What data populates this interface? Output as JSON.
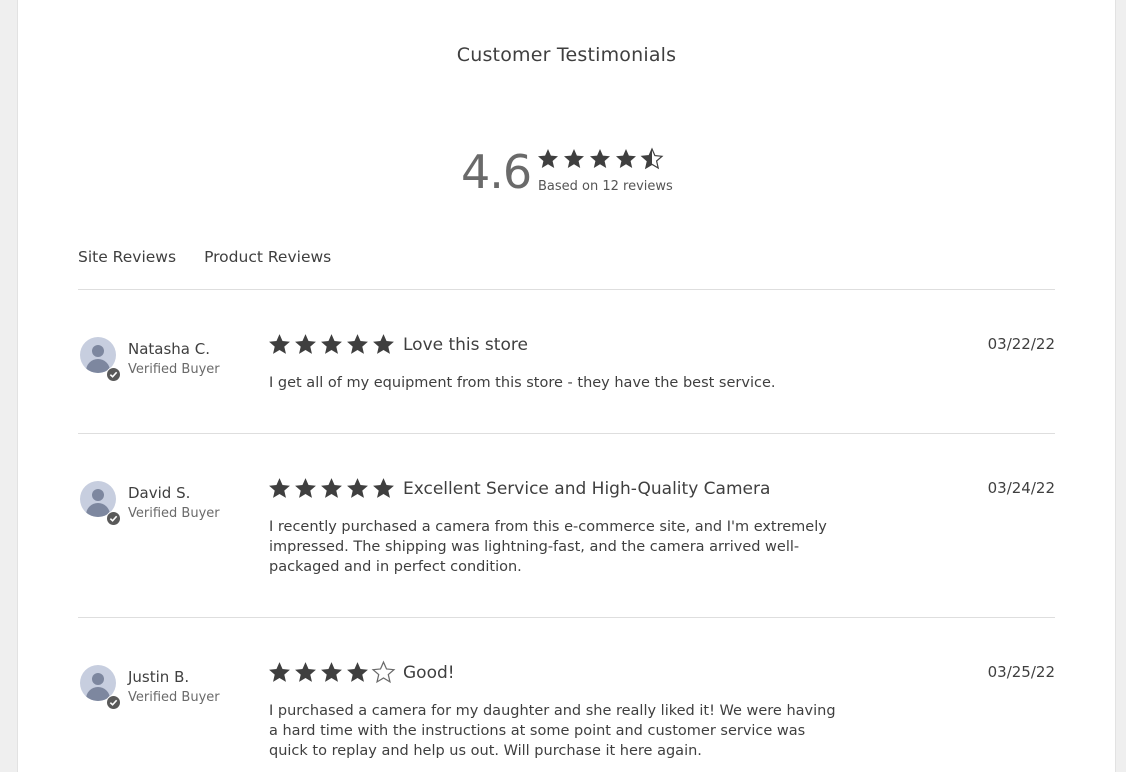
{
  "page": {
    "title": "Customer Testimonials"
  },
  "summary": {
    "average": "4.6",
    "rating_value": 4.6,
    "based_on": "Based on 12 reviews"
  },
  "tabs": [
    {
      "label": "Site Reviews"
    },
    {
      "label": "Product Reviews"
    }
  ],
  "colors": {
    "star": "#3f3f3f",
    "star_empty_outline": "#6a6a6a",
    "text": "#3f3f3f",
    "muted": "#6a6a6a",
    "avatar_bg": "#c7cedf",
    "avatar_fg": "#7d879f",
    "divider": "#dedede"
  },
  "reviews": [
    {
      "name": "Natasha C.",
      "badge": "Verified Buyer",
      "rating": 5,
      "title": "Love this store",
      "date": "03/22/22",
      "body": "I get all of my equipment from this store - they have the best service."
    },
    {
      "name": "David S.",
      "badge": "Verified Buyer",
      "rating": 5,
      "title": "Excellent Service and High-Quality Camera",
      "date": "03/24/22",
      "body": "I recently purchased a camera from this e-commerce site, and I'm extremely impressed. The shipping was lightning-fast, and the camera arrived well-packaged and in perfect condition."
    },
    {
      "name": "Justin B.",
      "badge": "Verified Buyer",
      "rating": 4,
      "title": "Good!",
      "date": "03/25/22",
      "body": "I purchased a camera for my daughter and she really liked it! We were having a hard time with the instructions at some point and customer service was quick to replay and help us out. Will purchase it here again."
    }
  ]
}
